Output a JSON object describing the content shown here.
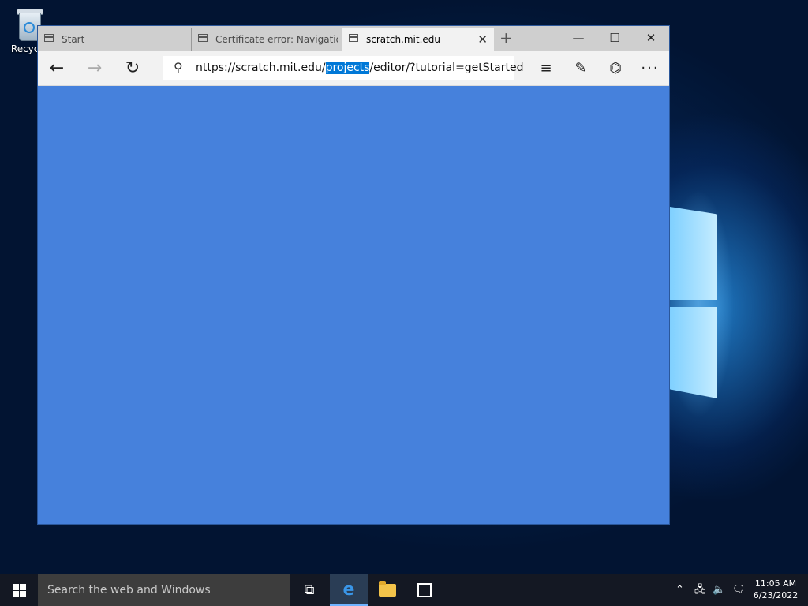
{
  "desktop": {
    "recycle_bin_label": "Recycle"
  },
  "browser": {
    "tabs": [
      {
        "label": "Start",
        "active": false
      },
      {
        "label": "Certificate error: Navigation",
        "active": false
      },
      {
        "label": "scratch.mit.edu",
        "active": true
      }
    ],
    "close_tab_symbol": "✕",
    "new_tab_symbol": "+",
    "window_controls": {
      "minimize": "—",
      "maximize": "☐",
      "close": "✕"
    },
    "address": {
      "prefix": "nttps://scratch.mit.edu/",
      "selected": "projects",
      "suffix": "/editor/?tutorial=getStarted"
    },
    "nav": {
      "back": "←",
      "forward": "→",
      "refresh": "↻"
    },
    "tools": {
      "hub": "≡",
      "notes": "✎",
      "share": "⌬",
      "more": "···"
    },
    "page_background": "#4681dc"
  },
  "taskbar": {
    "search_placeholder": "Search the web and Windows",
    "edge_glyph": "e",
    "task_view_glyph": "⧉",
    "tray": {
      "chevron": "⌃",
      "network": "🖧",
      "volume": "🔈",
      "notifications": "🗨"
    },
    "clock": {
      "time": "11:05 AM",
      "date": "6/23/2022"
    }
  }
}
